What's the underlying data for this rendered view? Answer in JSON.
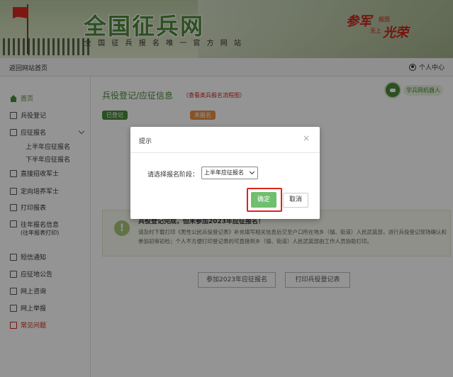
{
  "banner": {
    "brand": "全国征兵网",
    "slogan": "全 国 征 兵 报 名 唯 一 官 方 网 站",
    "motto": {
      "part1": "参军",
      "part2": "报国",
      "part3": "无上",
      "part4": "光荣"
    }
  },
  "topbar": {
    "home_link": "返回网站首页",
    "user_center": "个人中心"
  },
  "sidebar": {
    "items": [
      {
        "label": "首页"
      },
      {
        "label": "兵役登记"
      },
      {
        "label": "应征报名"
      },
      {
        "label": "直接招收军士"
      },
      {
        "label": "定向培养军士"
      },
      {
        "label": "打印报表"
      },
      {
        "label": "往年报名信息",
        "sub": "(往年报表打印)"
      },
      {
        "label": "短信通知"
      },
      {
        "label": "应征地公告"
      },
      {
        "label": "网上咨询"
      },
      {
        "label": "网上举报"
      },
      {
        "label": "常见问题"
      }
    ],
    "sub_items": [
      "上半年应征报名",
      "下半年应征报名"
    ]
  },
  "main": {
    "title": "兵役登记/应征信息",
    "title_link": "（查看类兵报名流程图）",
    "robot_label": "学兵网机器人",
    "tag_done": "已登记",
    "tag_todo": "未报名",
    "notice_title": "兵役登记完成，但未参加2023年应征报名！",
    "notice_body": "请及时下载打印《男性公民兵役登记表》补充填写相关信息后交至户口所在地乡（镇、街道）人民武装部，进行兵役登记现场确认和参加初审初检；个人不方便打印登记表的可直接到乡（镇、街道）人民武装部由工作人员协助打印。",
    "btn_apply": "参加2023年应征报名",
    "btn_print": "打印兵役登记表"
  },
  "dialog": {
    "title": "提示",
    "close": "×",
    "label": "请选择报名阶段：",
    "select_value": "上半年应征报名",
    "ok": "确定",
    "cancel": "取消"
  },
  "colors": {
    "accent": "#4a8a3a",
    "alert": "#e0241a",
    "ok_button": "#6fbf6f"
  }
}
